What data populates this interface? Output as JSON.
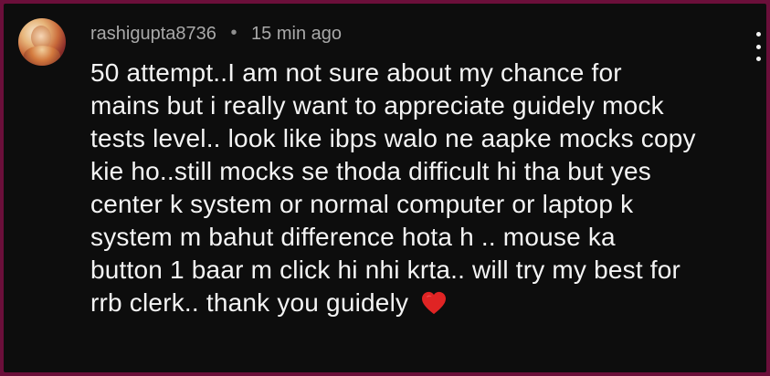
{
  "comment": {
    "username": "rashigupta8736",
    "separator": "•",
    "time_ago": "15 min ago",
    "lines": [
      "50 attempt..I am not sure about my chance for",
      "mains but i really want to appreciate guidely mock",
      "tests level.. look like ibps walo ne aapke mocks copy",
      "kie ho..still mocks se thoda difficult hi tha but yes",
      "center k system or normal computer or laptop k",
      "system m bahut difference hota h .. mouse ka",
      "button 1 baar m click hi nhi krta.. will try my best for",
      "rrb clerk.. thank you guidely"
    ],
    "emoji": "heart-icon"
  },
  "colors": {
    "page_border": "#6b0f3a",
    "background": "#0d0d0d",
    "meta_text": "#a9a9a9",
    "body_text": "#f4f4f4",
    "heart": "#e02424"
  }
}
